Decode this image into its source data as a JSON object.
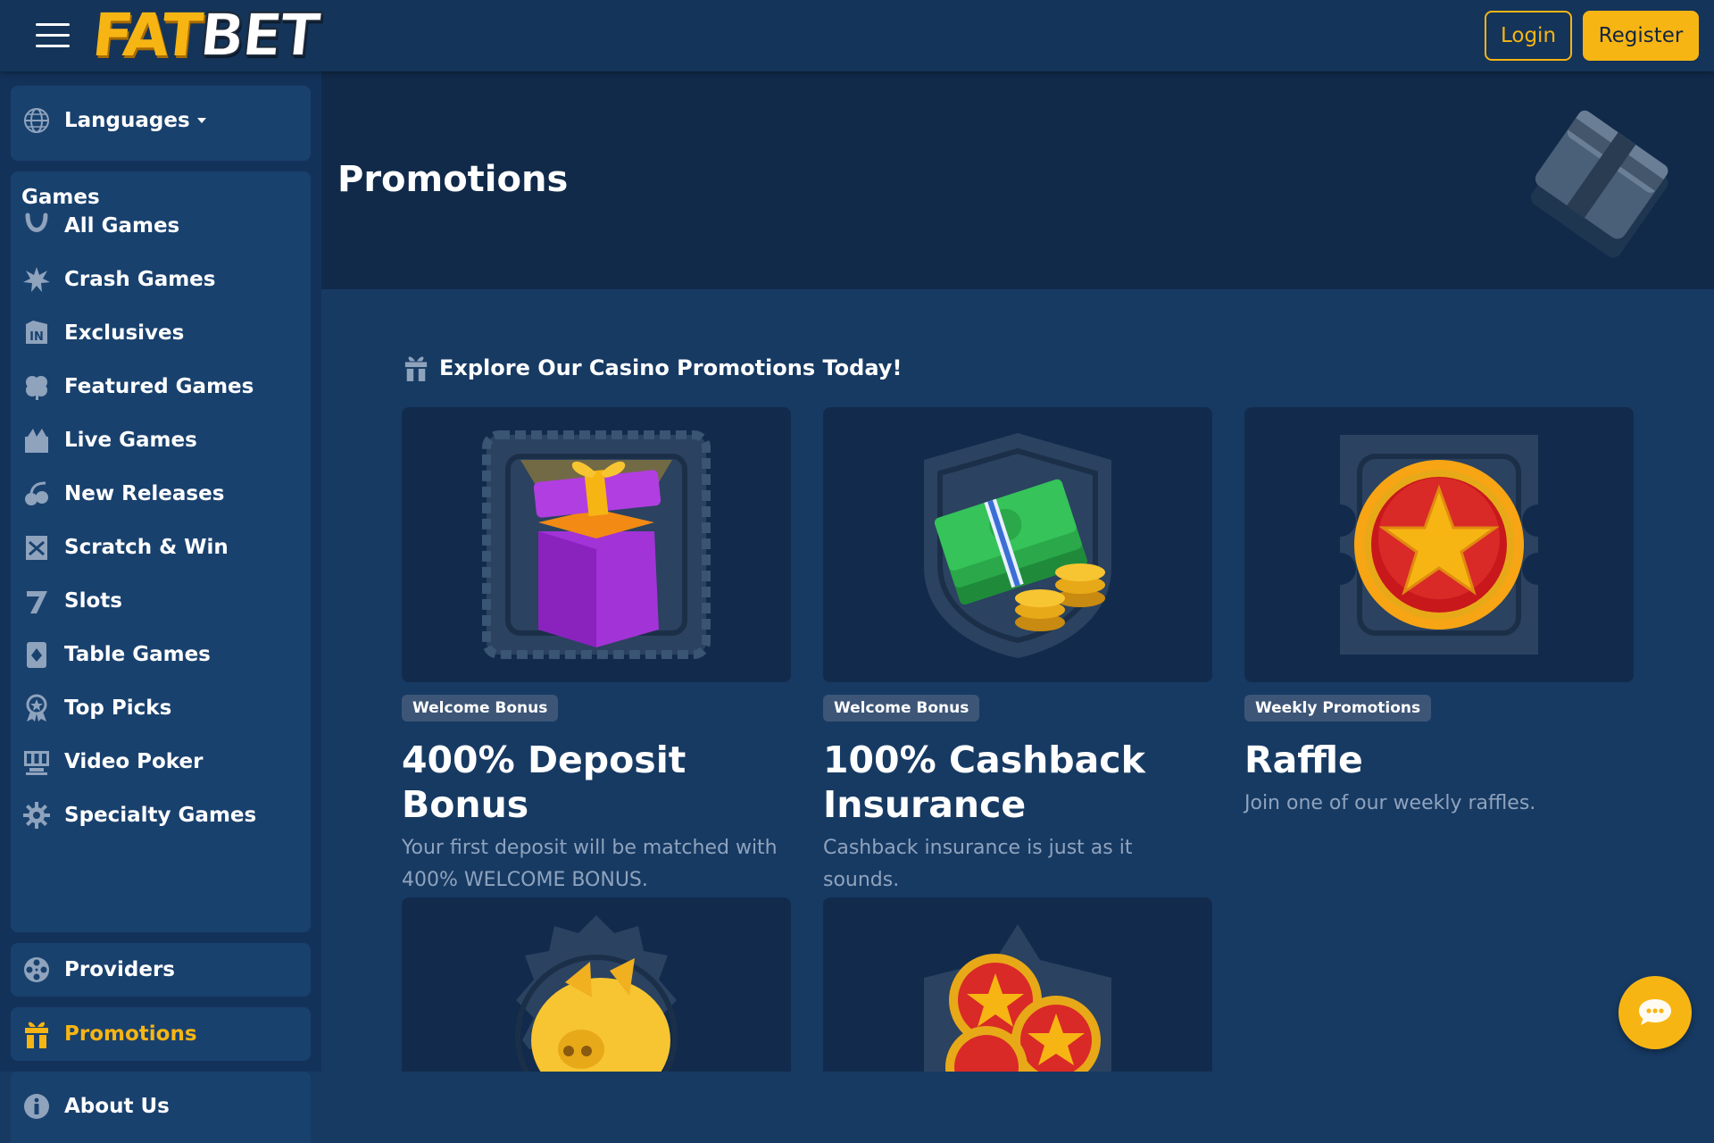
{
  "header": {
    "logo_fat": "FAT",
    "logo_bet": "BET",
    "login_label": "Login",
    "register_label": "Register"
  },
  "sidebar": {
    "languages_label": "Languages",
    "games_heading": "Games",
    "game_items": [
      {
        "label": "All Games",
        "icon": "horseshoe-icon"
      },
      {
        "label": "Crash Games",
        "icon": "explosion-icon"
      },
      {
        "label": "Exclusives",
        "icon": "exclusive-icon"
      },
      {
        "label": "Featured Games",
        "icon": "clover-icon"
      },
      {
        "label": "Live Games",
        "icon": "live-icon"
      },
      {
        "label": "New Releases",
        "icon": "cherry-icon"
      },
      {
        "label": "Scratch & Win",
        "icon": "scratch-ticket-icon"
      },
      {
        "label": "Slots",
        "icon": "seven-icon"
      },
      {
        "label": "Table Games",
        "icon": "playing-card-icon"
      },
      {
        "label": "Top Picks",
        "icon": "award-icon"
      },
      {
        "label": "Video Poker",
        "icon": "video-poker-icon"
      },
      {
        "label": "Specialty Games",
        "icon": "cog-icon"
      }
    ],
    "providers_label": "Providers",
    "promotions_label": "Promotions",
    "about_label": "About Us"
  },
  "hero": {
    "title": "Promotions"
  },
  "section": {
    "title": "Explore Our Casino Promotions Today!"
  },
  "cards": [
    {
      "badge": "Welcome Bonus",
      "title": "400% Deposit Bonus",
      "description": "Your first deposit will be matched with 400% WELCOME BONUS."
    },
    {
      "badge": "Welcome Bonus",
      "title": "100% Cashback Insurance",
      "description": "Cashback insurance is just as it sounds."
    },
    {
      "badge": "Weekly Promotions",
      "title": "Raffle",
      "description": "Join one of our weekly raffles."
    }
  ],
  "colors": {
    "accent": "#f7b514",
    "background": "#173a63",
    "sidebar": "#13325a",
    "card": "#122b4c",
    "muted_text": "#8fa3bd"
  }
}
